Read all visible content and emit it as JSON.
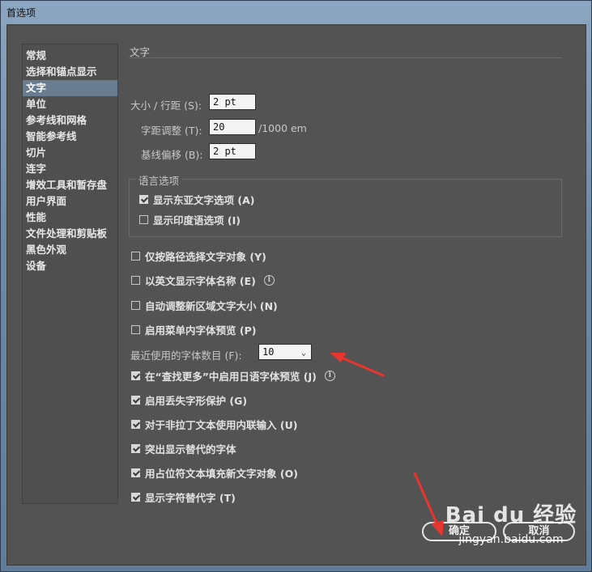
{
  "window": {
    "title": "首选项"
  },
  "sidebar": {
    "items": [
      {
        "label": "常规",
        "selected": false
      },
      {
        "label": "选择和锚点显示",
        "selected": false
      },
      {
        "label": "文字",
        "selected": true
      },
      {
        "label": "单位",
        "selected": false
      },
      {
        "label": "参考线和网格",
        "selected": false
      },
      {
        "label": "智能参考线",
        "selected": false
      },
      {
        "label": "切片",
        "selected": false
      },
      {
        "label": "连字",
        "selected": false
      },
      {
        "label": "增效工具和暂存盘",
        "selected": false
      },
      {
        "label": "用户界面",
        "selected": false
      },
      {
        "label": "性能",
        "selected": false
      },
      {
        "label": "文件处理和剪贴板",
        "selected": false
      },
      {
        "label": "黑色外观",
        "selected": false
      },
      {
        "label": "设备",
        "selected": false
      }
    ]
  },
  "main": {
    "section_title": "文字",
    "size_leading": {
      "label": "大小 / 行距 (S):",
      "value": "2 pt"
    },
    "tracking": {
      "label": "字距调整 (T):",
      "value": "20",
      "unit": "/1000 em"
    },
    "baseline_shift": {
      "label": "基线偏移 (B):",
      "value": "2 pt"
    },
    "language_group": {
      "title": "语言选项",
      "options": [
        {
          "label": "显示东亚文字选项 (A)",
          "checked": true
        },
        {
          "label": "显示印度语选项 (I)",
          "checked": false
        }
      ]
    },
    "options_a": [
      {
        "label": "仅按路径选择文字对象 (Y)",
        "checked": false,
        "info": false
      },
      {
        "label": "以英文显示字体名称 (E)",
        "checked": false,
        "info": true
      },
      {
        "label": "自动调整新区域文字大小 (N)",
        "checked": false,
        "info": false
      },
      {
        "label": "启用菜单内字体预览 (P)",
        "checked": false,
        "info": false
      }
    ],
    "recent_fonts": {
      "label": "最近使用的字体数目 (F):",
      "value": "10"
    },
    "options_b": [
      {
        "label": "在“查找更多”中启用日语字体预览 (J)",
        "checked": true,
        "info": true
      },
      {
        "label": "启用丢失字形保护 (G)",
        "checked": true,
        "info": false
      },
      {
        "label": "对于非拉丁文本使用内联输入 (U)",
        "checked": true,
        "info": false
      },
      {
        "label": "突出显示替代的字体",
        "checked": true,
        "info": false
      },
      {
        "label": "用占位符文本填充新文字对象 (O)",
        "checked": true,
        "info": false
      },
      {
        "label": "显示字符替代字 (T)",
        "checked": true,
        "info": false
      }
    ],
    "info_glyph": "i"
  },
  "footer": {
    "ok_label": "确定",
    "cancel_label": "取消"
  },
  "watermark": {
    "logo": "Bai du 经验",
    "url": "jingyan.baidu.com"
  },
  "colors": {
    "arrow": "#e8352e",
    "dialog_bg": "#535353",
    "selected": "#6a7d90"
  }
}
